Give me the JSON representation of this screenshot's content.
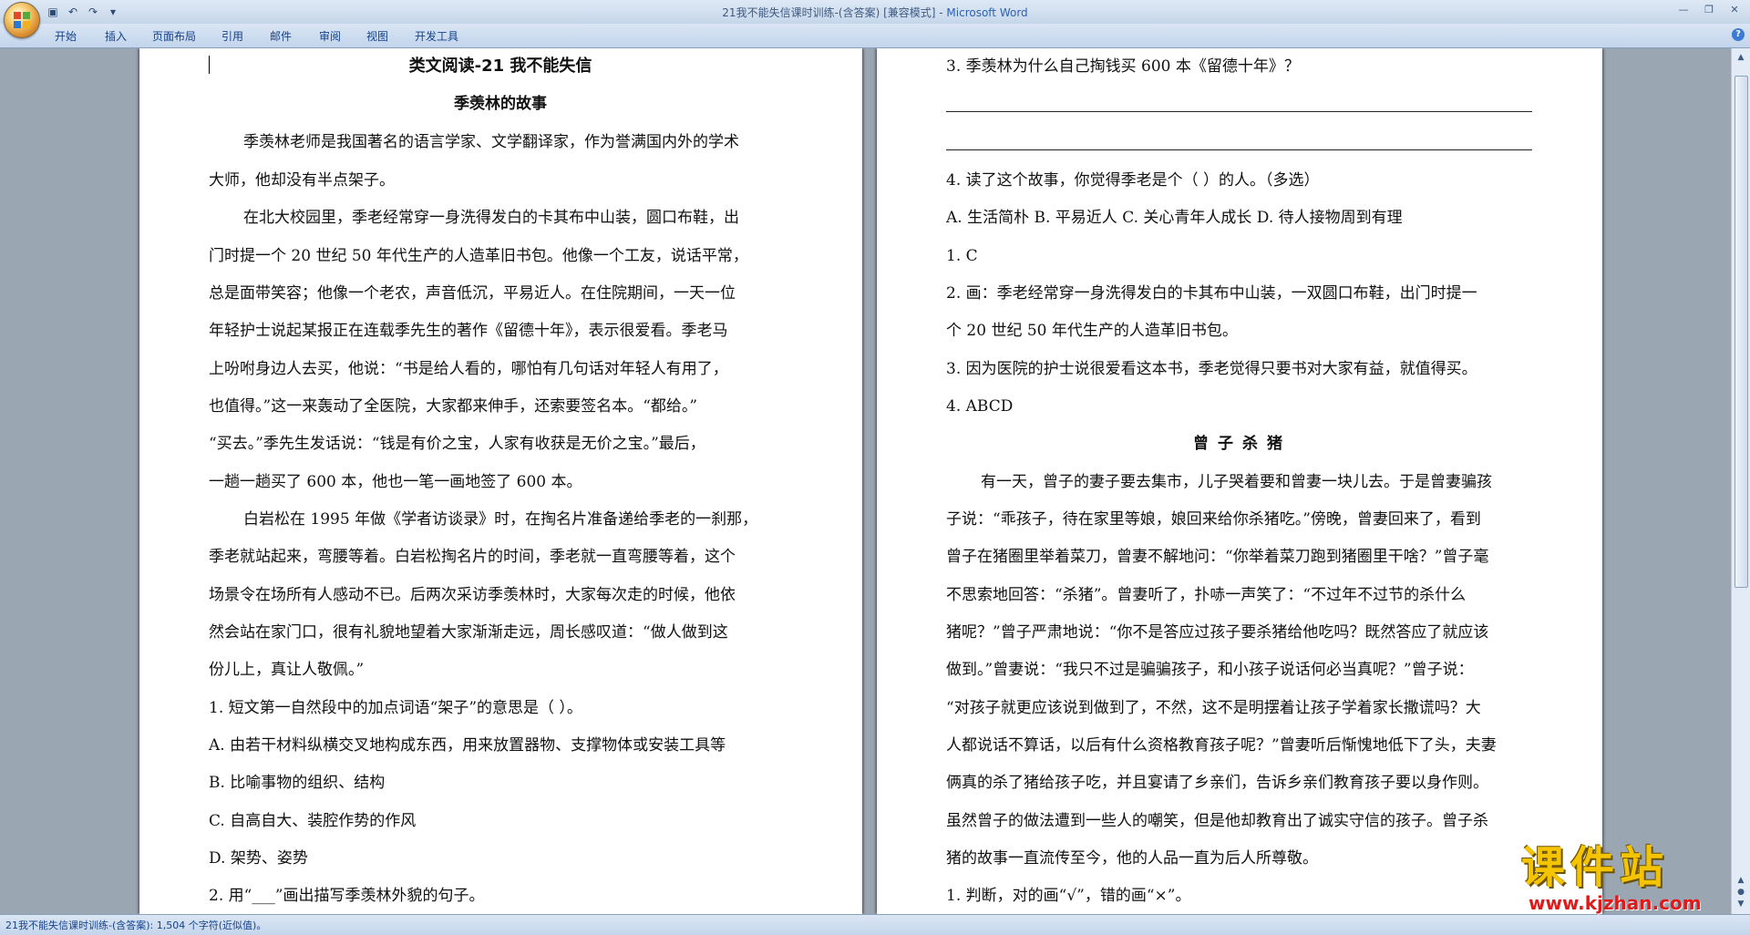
{
  "window": {
    "title_doc": "21我不能失信课时训练-(含答案) [兼容模式] - ",
    "title_app": "Microsoft Word"
  },
  "ribbon": {
    "tabs": [
      "开始",
      "插入",
      "页面布局",
      "引用",
      "邮件",
      "审阅",
      "视图",
      "开发工具"
    ]
  },
  "page1": {
    "heading": "类文阅读-21 我不能失信",
    "subheading": "季羡林的故事",
    "lines": [
      "季羡林老师是我国著名的语言学家、文学翻译家，作为誉满国内外的学术",
      "大师，他却没有半点架子。",
      "在北大校园里，季老经常穿一身洗得发白的卡其布中山装，圆口布鞋，出",
      "门时提一个 20 世纪 50 年代生产的人造革旧书包。他像一个工友，说话平常，",
      "总是面带笑容；他像一个老农，声音低沉，平易近人。在住院期间，一天一位",
      "年轻护士说起某报正在连载季先生的著作《留德十年》，表示很爱看。季老马",
      "上吩咐身边人去买，他说：“书是给人看的，哪怕有几句话对年轻人有用了，",
      "也值得。”这一来轰动了全医院，大家都来伸手，还索要签名本。“都给。”",
      "“买去。”季先生发话说：“钱是有价之宝，人家有收获是无价之宝。”最后，",
      "一趟一趟买了 600 本，他也一笔一画地签了 600 本。",
      "白岩松在 1995 年做《学者访谈录》时，在掏名片准备递给季老的一刹那，",
      "季老就站起来，弯腰等着。白岩松掏名片的时间，季老就一直弯腰等着，这个",
      "场景令在场所有人感动不已。后两次采访季羡林时，大家每次走的时候，他依",
      "然会站在家门口，很有礼貌地望着大家渐渐走远，周长感叹道：“做人做到这",
      "份儿上，真让人敬佩。”",
      "1. 短文第一自然段中的加点词语“架子”的意思是（      ）。",
      "A. 由若干材料纵横交叉地构成东西，用来放置器物、支撑物体或安装工具等",
      "B. 比喻事物的组织、结构",
      "C. 自高自大、装腔作势的作风",
      "D. 架势、姿势",
      "2. 用“___”画出描写季羡林外貌的句子。"
    ]
  },
  "page2": {
    "lines_top": [
      "3. 季羡林为什么自己掏钱买 600 本《留德十年》？",
      "4. 读了这个故事，你觉得季老是个（      ）的人。（多选）",
      "A. 生活简朴   B. 平易近人   C. 关心青年人成长   D. 待人接物周到有理",
      "1. C",
      "2. 画：季老经常穿一身洗得发白的卡其布中山装，一双圆口布鞋，出门时提一",
      "个 20 世纪 50 年代生产的人造革旧书包。",
      "3. 因为医院的护士说很爱看这本书，季老觉得只要书对大家有益，就值得买。",
      "4. ABCD"
    ],
    "story_title": "曾子杀猪",
    "story_lines": [
      "有一天，曾子的妻子要去集市，儿子哭着要和曾妻一块儿去。于是曾妻骗孩",
      "子说：“乖孩子，待在家里等娘，娘回来给你杀猪吃。”傍晚，曾妻回来了，看到",
      "曾子在猪圈里举着菜刀，曾妻不解地问：“你举着菜刀跑到猪圈里干啥？”曾子毫",
      "不思索地回答：“杀猪”。曾妻听了，扑哧一声笑了：“不过年不过节的杀什么",
      "猪呢？”曾子严肃地说：“你不是答应过孩子要杀猪给他吃吗？既然答应了就应该",
      "做到。”曾妻说：“我只不过是骗骗孩子，和小孩子说话何必当真呢？”曾子说：",
      "“对孩子就更应该说到做到了，不然，这不是明摆着让孩子学着家长撒谎吗？大",
      "人都说话不算话，以后有什么资格教育孩子呢？”曾妻听后惭愧地低下了头，夫妻",
      "俩真的杀了猪给孩子吃，并且宴请了乡亲们，告诉乡亲们教育孩子要以身作则。",
      "虽然曾子的做法遭到一些人的嘲笑，但是他却教育出了诚实守信的孩子。曾子杀",
      "猪的故事一直流传至今，他的人品一直为后人所尊敬。",
      "1. 判断，对的画“√”，错的画“×”。"
    ]
  },
  "status": {
    "text": "21我不能失信课时训练-(含答案): 1,504 个字符(近似值)。"
  },
  "watermark": {
    "main": "课件站",
    "url": "www.kjzhan.com"
  },
  "icons": [
    "office-button-icon",
    "save-icon",
    "undo-icon",
    "redo-icon",
    "customize-qat-icon",
    "minimize-icon",
    "maximize-icon",
    "close-icon",
    "help-icon"
  ]
}
